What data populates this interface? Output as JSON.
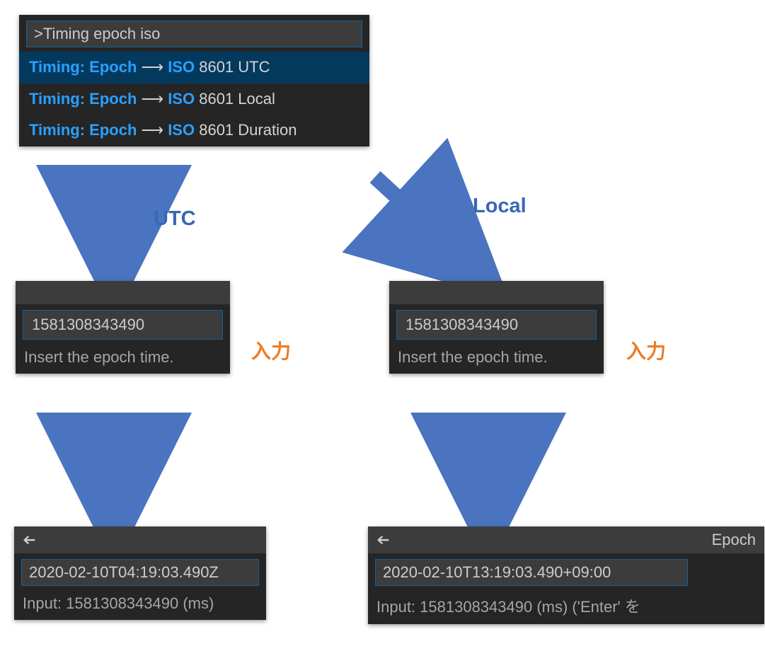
{
  "palette": {
    "query": ">Timing epoch iso",
    "items": [
      {
        "timing": "Timing:",
        "epoch": "Epoch",
        "arrow": "⟶",
        "iso": "ISO",
        "rest": "8601 UTC"
      },
      {
        "timing": "Timing:",
        "epoch": "Epoch",
        "arrow": "⟶",
        "iso": "ISO",
        "rest": "8601 Local"
      },
      {
        "timing": "Timing:",
        "epoch": "Epoch",
        "arrow": "⟶",
        "iso": "ISO",
        "rest": "8601 Duration"
      }
    ]
  },
  "branches": {
    "utc": "UTC",
    "local": "Local"
  },
  "jp_input": "入力",
  "utc_input": {
    "value": "1581308343490",
    "hint": "Insert the epoch time."
  },
  "local_input": {
    "value": "1581308343490",
    "hint": "Insert the epoch time."
  },
  "utc_result": {
    "title_right": "",
    "value": "2020-02-10T04:19:03.490Z",
    "hint": "Input: 1581308343490 (ms)"
  },
  "local_result": {
    "title_right": "Epoch",
    "value": "2020-02-10T13:19:03.490+09:00",
    "hint": "Input: 1581308343490 (ms) ('Enter' を"
  }
}
